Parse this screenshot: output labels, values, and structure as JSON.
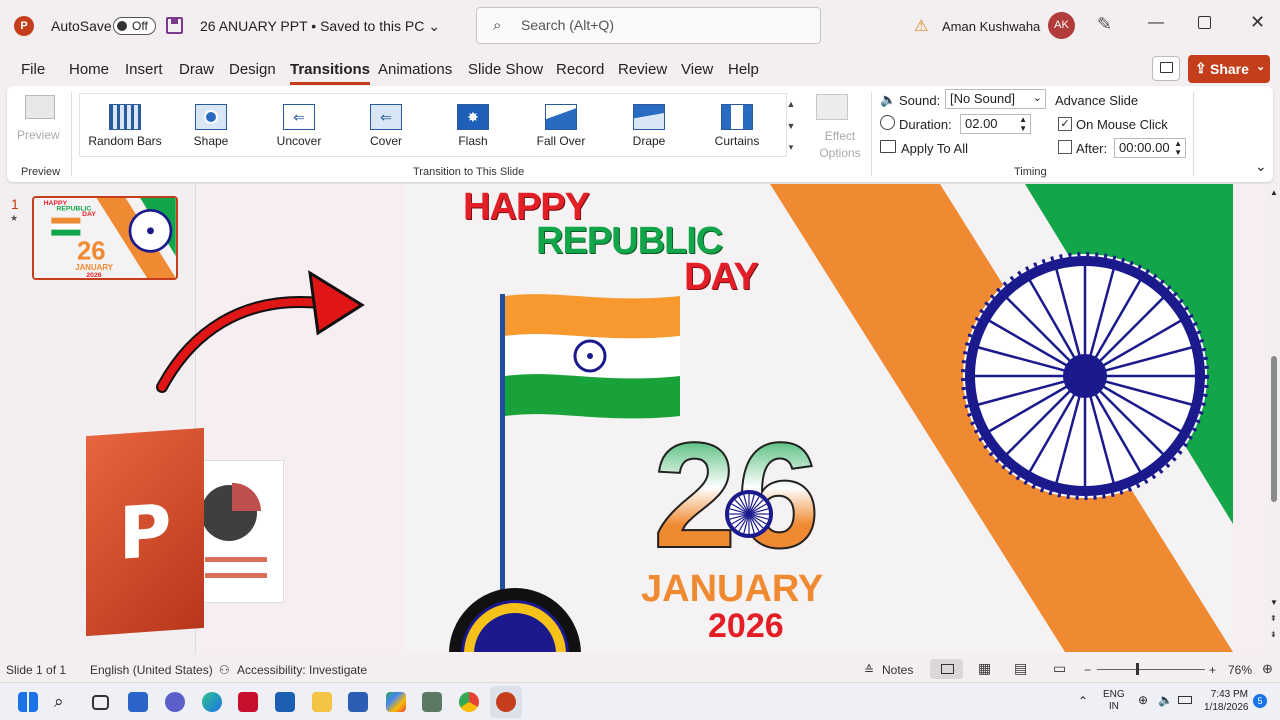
{
  "titlebar": {
    "app_logo": "P",
    "autosave_label": "AutoSave",
    "autosave_state": "Off",
    "document_title": "26 ANUARY PPT • Saved to this PC ⌄",
    "search_placeholder": "Search (Alt+Q)",
    "user_name": "Aman Kushwaha",
    "user_initials": "AK"
  },
  "menu": {
    "items": [
      "File",
      "Home",
      "Insert",
      "Draw",
      "Design",
      "Transitions",
      "Animations",
      "Slide Show",
      "Record",
      "Review",
      "View",
      "Help"
    ],
    "active": "Transitions",
    "share_label": "Share"
  },
  "ribbon": {
    "preview_button": "Preview",
    "preview_group": "Preview",
    "transitions": [
      "Random Bars",
      "Shape",
      "Uncover",
      "Cover",
      "Flash",
      "Fall Over",
      "Drape",
      "Curtains"
    ],
    "transition_group": "Transition to This Slide",
    "effect_options": "Effect Options",
    "sound_label": "Sound:",
    "sound_value": "[No Sound]",
    "duration_label": "Duration:",
    "duration_value": "02.00",
    "apply_all": "Apply To All",
    "advance_label": "Advance Slide",
    "on_mouse_click": "On Mouse Click",
    "on_mouse_click_checked": true,
    "after_label": "After:",
    "after_value": "00:00.00",
    "timing_group": "Timing"
  },
  "thumbnails": {
    "slide_number": "1"
  },
  "slide": {
    "line1": "HAPPY",
    "line2": "REPUBLIC",
    "line3": "DAY",
    "big_number": "26",
    "month": "JANUARY",
    "year": "2026",
    "colors": {
      "saffron": "#f08a32",
      "green": "#13a54a",
      "navy": "#1b1a8c",
      "red": "#e41e26"
    }
  },
  "statusbar": {
    "slide_count": "Slide 1 of 1",
    "language": "English (United States)",
    "accessibility": "Accessibility: Investigate",
    "notes": "Notes",
    "zoom": "76%"
  },
  "taskbar": {
    "lang_line1": "ENG",
    "lang_line2": "IN",
    "time": "7:43 PM",
    "date": "1/18/2026",
    "notif_count": "5"
  }
}
